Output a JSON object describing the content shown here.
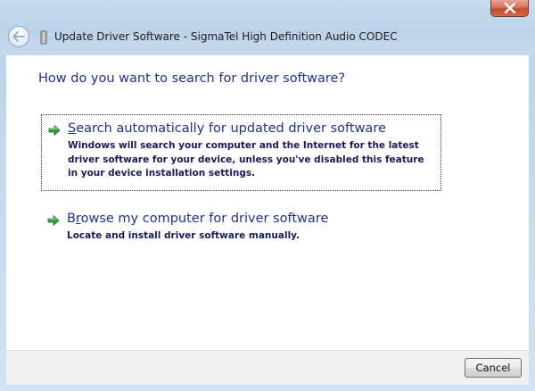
{
  "window": {
    "title": "Update Driver Software - SigmaTel High Definition Audio CODEC"
  },
  "titlebar": {
    "close_icon": "close-icon",
    "back_icon": "back-arrow-icon",
    "device_icon": "audio-device-icon"
  },
  "main": {
    "heading": "How do you want to search for driver software?",
    "options": [
      {
        "accel": "S",
        "title_rest": "earch automatically for updated driver software",
        "description": "Windows will search your computer and the Internet for the latest driver software for your device, unless you've disabled this feature in your device installation settings.",
        "icon": "green-arrow-icon"
      },
      {
        "accel": "r",
        "title_pre": "B",
        "title_rest": "owse my computer for driver software",
        "description": "Locate and install driver software manually.",
        "icon": "green-arrow-icon"
      }
    ]
  },
  "footer": {
    "cancel_label": "Cancel"
  },
  "colors": {
    "link_blue": "#1e3287",
    "arrow_green": "#2f9e3a",
    "close_red": "#c14b2e"
  }
}
